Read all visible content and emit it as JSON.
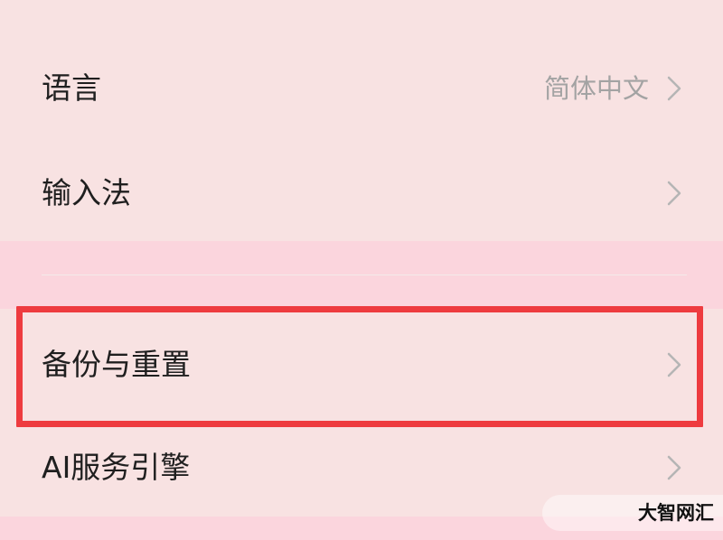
{
  "settings": {
    "language": {
      "label": "语言",
      "value": "简体中文",
      "chevron_icon": "chevron-right-icon"
    },
    "input_method": {
      "label": "输入法",
      "chevron_icon": "chevron-right-icon"
    },
    "backup_reset": {
      "label": "备份与重置",
      "chevron_icon": "chevron-right-icon",
      "highlighted": true
    },
    "ai_engine": {
      "label": "AI服务引擎",
      "chevron_icon": "chevron-right-icon"
    }
  },
  "watermark": {
    "text": "大智网汇"
  },
  "colors": {
    "background": "#f8e2e2",
    "section_gap": "#fbd5dd",
    "highlight_border": "#ee3b3f",
    "label_text": "#1f1f1f",
    "secondary_text": "#a3a3a3",
    "chevron": "#b5b5b5"
  }
}
